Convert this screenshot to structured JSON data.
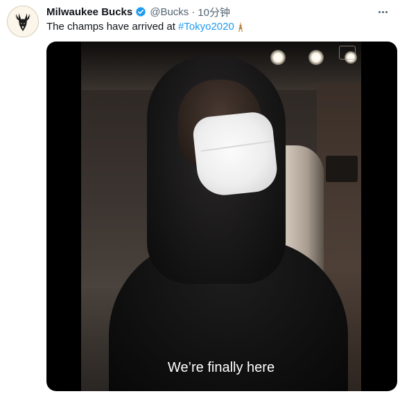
{
  "account": {
    "display_name": "Milwaukee Bucks",
    "handle": "@Bucks",
    "separator": "·",
    "time": "10分钟",
    "verified": true
  },
  "tweet": {
    "text_prefix": "The champs have arrived at",
    "hashtag": "#Tokyo2020",
    "emoji": "tokyo-tower-emoji"
  },
  "media": {
    "type": "video",
    "caption": "We’re finally here"
  },
  "colors": {
    "link": "#1d9bf0",
    "verified": "#1d9bf0",
    "text": "#0f1419",
    "secondary": "#536471"
  }
}
